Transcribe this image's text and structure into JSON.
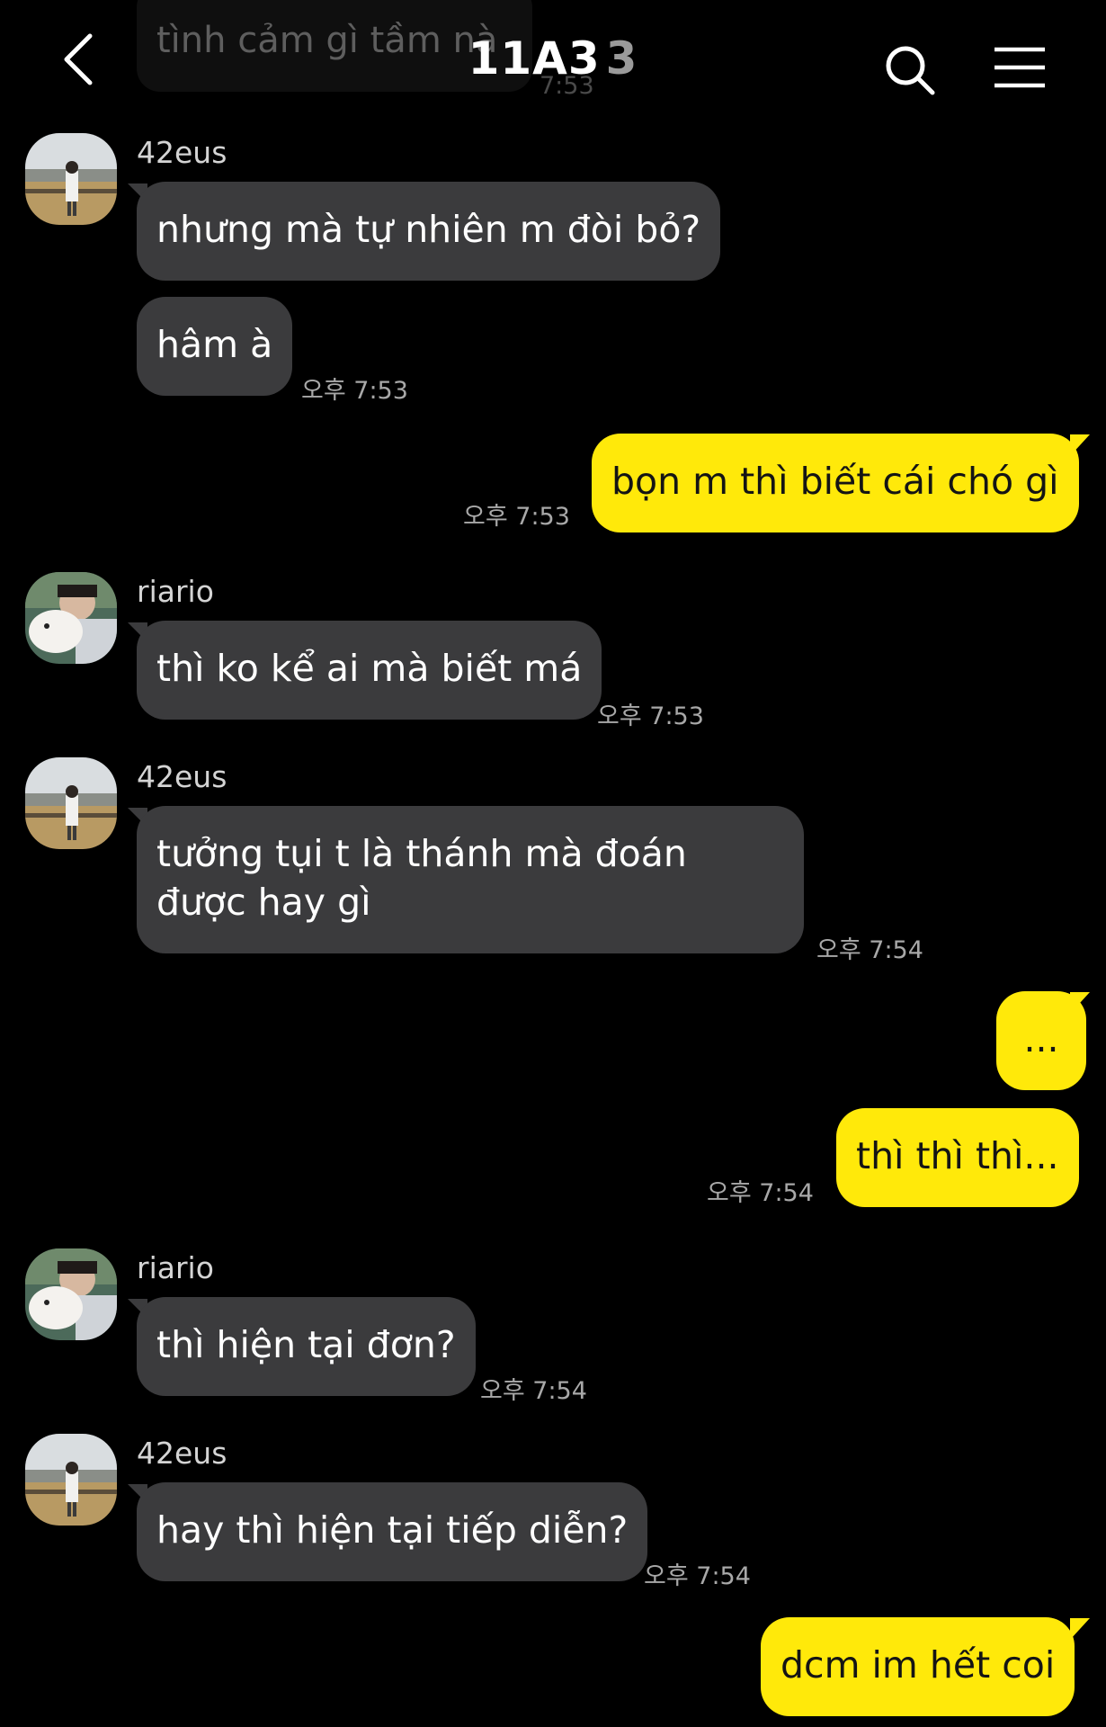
{
  "header": {
    "title": "11A3",
    "member_count": "3",
    "back_icon": "chevron-left-icon",
    "search_icon": "search-icon",
    "menu_icon": "hamburger-menu-icon"
  },
  "previous_message": {
    "text": "tình cảm gì tầm nà",
    "time": "7:53"
  },
  "colors": {
    "background": "#000000",
    "incoming_bubble": "#3b3b3d",
    "outgoing_bubble": "#ffe90a"
  },
  "messages": [
    {
      "direction": "in",
      "sender": "42eus",
      "text": "nhưng mà tự nhiên m đòi bỏ?",
      "time": ""
    },
    {
      "direction": "in",
      "sender": "",
      "text": "hâm à",
      "time": "오후 7:53"
    },
    {
      "direction": "out",
      "text": "bọn m thì biết cái chó gì",
      "time": "오후 7:53"
    },
    {
      "direction": "in",
      "sender": "riario",
      "text": "thì ko kể ai mà biết má",
      "time": "오후 7:53"
    },
    {
      "direction": "in",
      "sender": "42eus",
      "text": "tưởng tụi t là thánh mà đoán được hay gì",
      "time": "오후 7:54"
    },
    {
      "direction": "out",
      "text": "...",
      "time": ""
    },
    {
      "direction": "out",
      "text": "thì thì thì...",
      "time": "오후 7:54"
    },
    {
      "direction": "in",
      "sender": "riario",
      "text": "thì hiện tại đơn?",
      "time": "오후 7:54"
    },
    {
      "direction": "in",
      "sender": "42eus",
      "text": "hay thì hiện tại tiếp diễn?",
      "time": "오후 7:54"
    },
    {
      "direction": "out",
      "text": "dcm im hết coi",
      "time": ""
    }
  ]
}
